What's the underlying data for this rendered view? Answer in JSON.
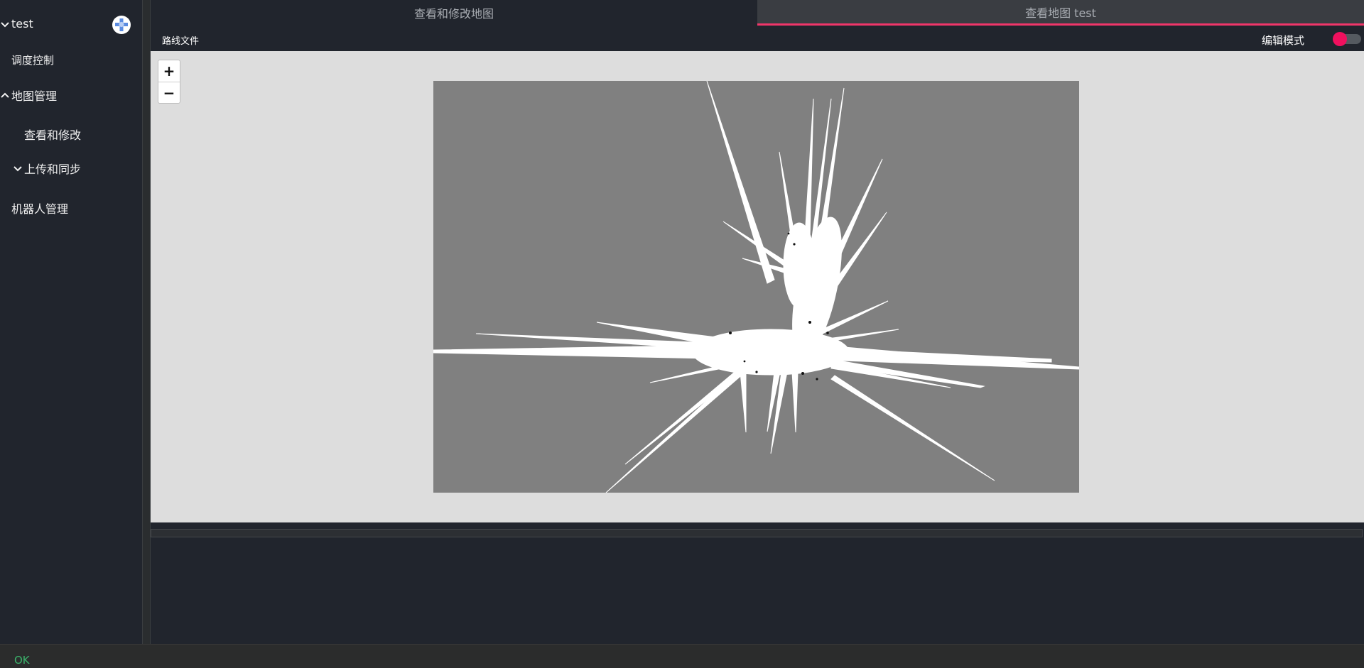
{
  "sidebar": {
    "root_label": "test",
    "items": [
      {
        "label": "调度控制"
      },
      {
        "label": "地图管理"
      },
      {
        "label": "查看和修改"
      },
      {
        "label": "上传和同步"
      },
      {
        "label": "机器人管理"
      }
    ],
    "logo_icon": "app-logo-icon"
  },
  "tabs": [
    {
      "label": "查看和修改地图",
      "active": false
    },
    {
      "label": "查看地图 test",
      "active": true
    }
  ],
  "toolbar": {
    "route_file_label": "路线文件",
    "edit_mode_label": "编辑模式",
    "edit_mode_on": false
  },
  "map": {
    "zoom_in": "+",
    "zoom_out": "−"
  },
  "status": {
    "text": "OK",
    "color": "#3bb36b"
  },
  "colors": {
    "accent": "#f0366a",
    "toggle_knob": "#f0105e",
    "background": "#21252d",
    "map_unknown": "#808080",
    "map_free": "#ffffff"
  }
}
